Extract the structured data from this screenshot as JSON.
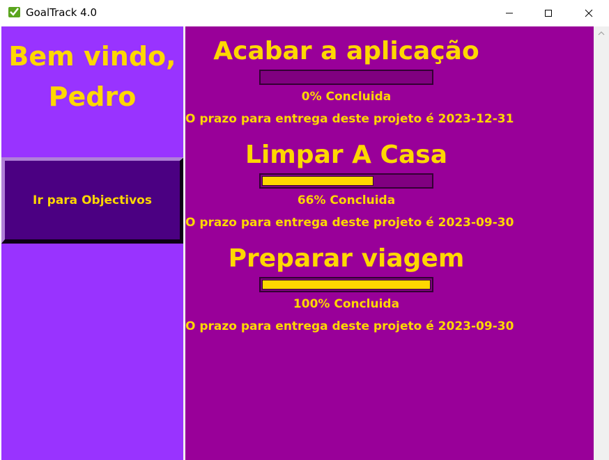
{
  "window": {
    "title": "GoalTrack 4.0",
    "icon": "check-icon"
  },
  "sidebar": {
    "welcome_line1": "Bem vindo,",
    "welcome_line2": "Pedro",
    "goals_button_label": "Ir para Objectivos"
  },
  "goals": [
    {
      "title": "Acabar a aplicação",
      "progress_percent": 0,
      "progress_text": "0% Concluida",
      "deadline_text": "O prazo para entrega deste projeto é 2023-12-31"
    },
    {
      "title": "Limpar A Casa",
      "progress_percent": 66,
      "progress_text": "66% Concluida",
      "deadline_text": "O prazo para entrega deste projeto é 2023-09-30"
    },
    {
      "title": "Preparar viagem",
      "progress_percent": 100,
      "progress_text": "100% Concluida",
      "deadline_text": "O prazo para entrega deste projeto é 2023-09-30"
    }
  ],
  "colors": {
    "sidebar_bg": "#9933ff",
    "main_bg": "#990099",
    "text_accent": "#ffd700",
    "button_bg": "#4b0082"
  }
}
